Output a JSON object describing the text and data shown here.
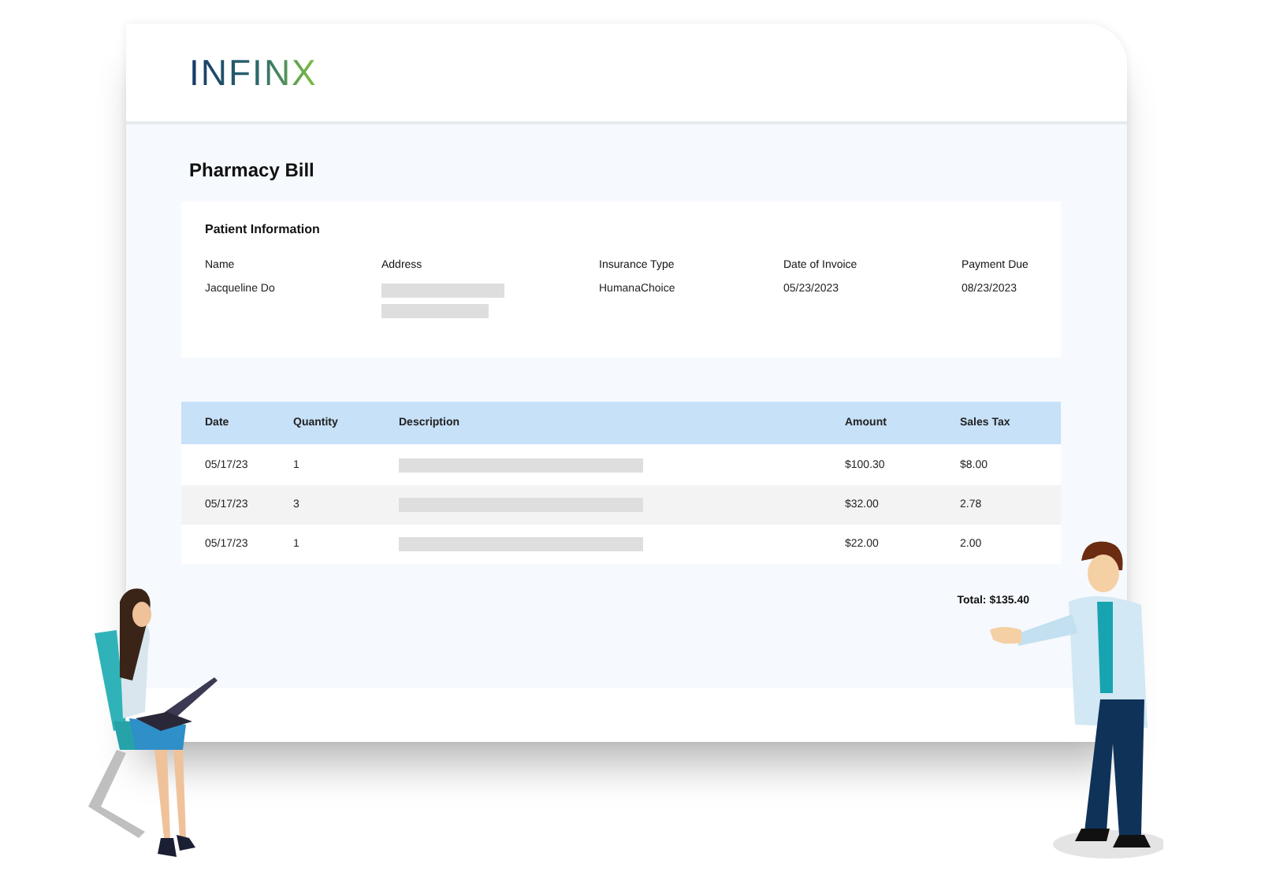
{
  "logo": "INFINX",
  "title": "Pharmacy Bill",
  "patient": {
    "heading": "Patient Information",
    "fields": [
      {
        "label": "Name",
        "value": "Jacqueline Do"
      },
      {
        "label": "Address",
        "kind": "redacted"
      },
      {
        "label": "Insurance Type",
        "value": "HumanaChoice"
      },
      {
        "label": "Date of Invoice",
        "value": "05/23/2023"
      },
      {
        "label": "Payment Due",
        "value": "08/23/2023"
      }
    ]
  },
  "table": {
    "columns": [
      "Date",
      "Quantity",
      "Description",
      "Amount",
      "Sales Tax"
    ],
    "rows": [
      [
        "05/17/23",
        "1",
        null,
        "$100.30",
        "$8.00"
      ],
      [
        "05/17/23",
        "3",
        null,
        "$32.00",
        "2.78"
      ],
      [
        "05/17/23",
        "1",
        null,
        "$22.00",
        "2.00"
      ]
    ]
  },
  "total": "Total: $135.40"
}
